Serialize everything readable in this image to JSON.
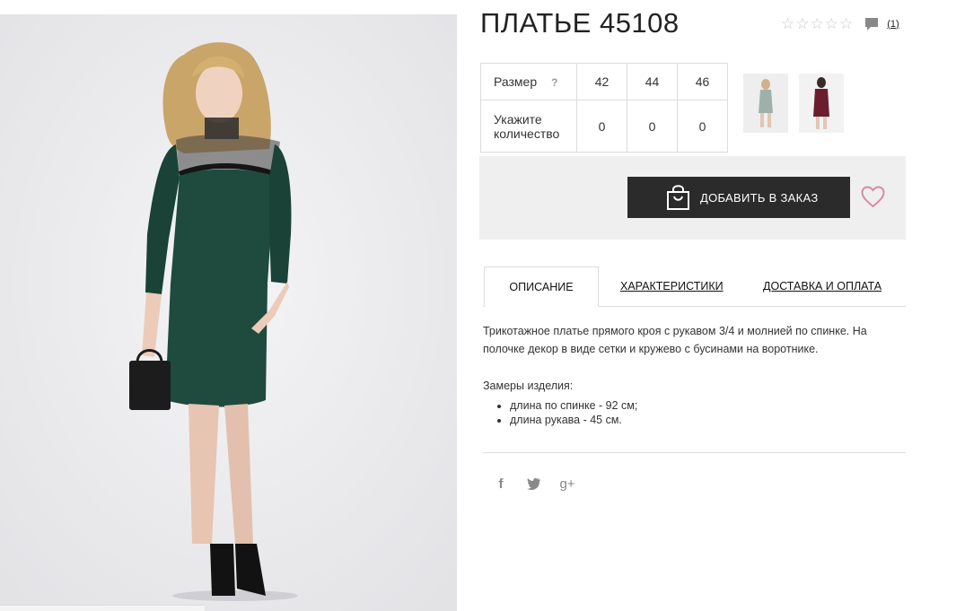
{
  "product": {
    "title": "ПЛАТЬЕ 45108",
    "rating_stars": 5,
    "review_count": "(1)"
  },
  "sizes": {
    "label": "Размер",
    "help": "?",
    "values": [
      "42",
      "44",
      "46"
    ],
    "qty_label": "Укажите количество",
    "quantities": [
      "0",
      "0",
      "0"
    ]
  },
  "order": {
    "add_label": "ДОБАВИТЬ В ЗАКАЗ"
  },
  "tabs": [
    {
      "label": "ОПИСАНИЕ"
    },
    {
      "label": "ХАРАКТЕРИСТИКИ"
    },
    {
      "label": "ДОСТАВКА И ОПЛАТА"
    }
  ],
  "description": {
    "text": "Трикотажное платье прямого кроя с рукавом 3/4 и молнией по спинке. На полочке декор в виде сетки и кружево с бусинами на воротнике.",
    "measures_title": "Замеры изделия:",
    "measures": [
      "длина по спинке - 92 см;",
      "длина рукава - 45 см."
    ]
  },
  "social": {
    "facebook": "f",
    "twitter": "🐦",
    "gplus": "g+"
  },
  "colors": {
    "button_bg": "#2b2b2b",
    "panel_bg": "#efefef",
    "heart": "#d98aa0",
    "dress_green": "#1f4a3e",
    "dress_burgundy": "#6b1d2e"
  }
}
